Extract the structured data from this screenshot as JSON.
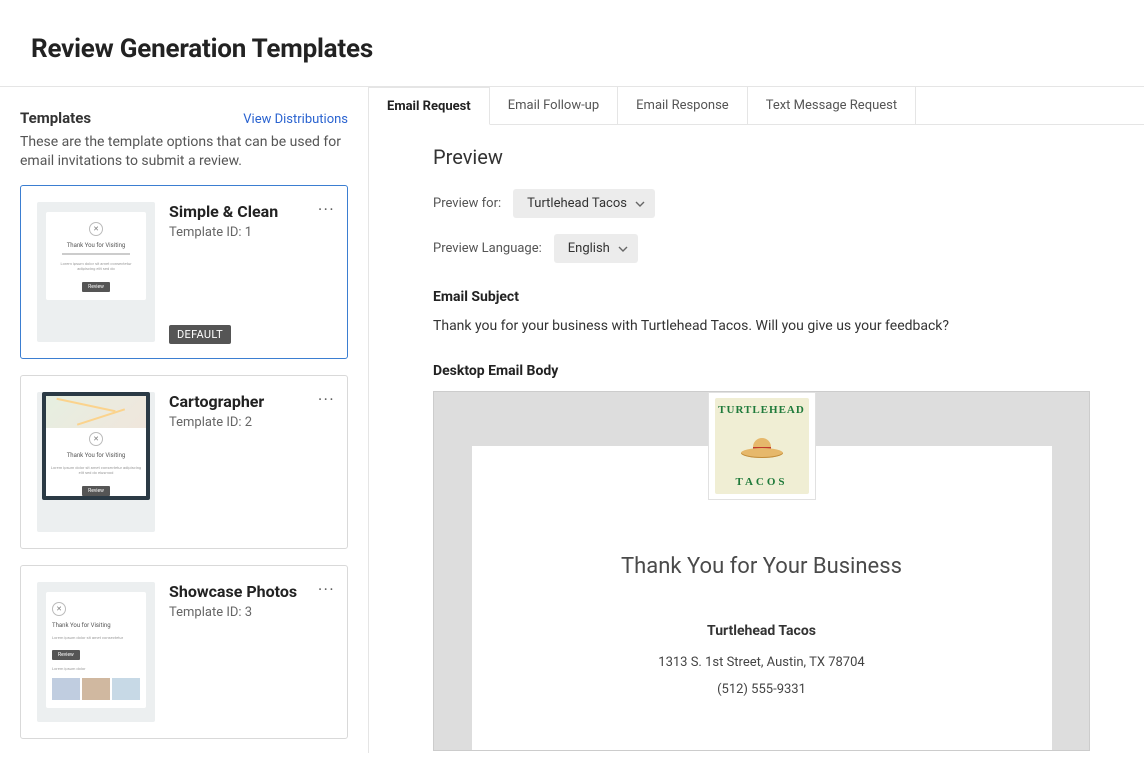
{
  "page": {
    "title": "Review Generation Templates"
  },
  "sidebar": {
    "heading": "Templates",
    "view_link": "View Distributions",
    "description": "These are the template options that can be used for email invitations to submit a review.",
    "default_badge": "DEFAULT",
    "templates": [
      {
        "name": "Simple & Clean",
        "id_label": "Template ID: 1",
        "selected": true,
        "default": true
      },
      {
        "name": "Cartographer",
        "id_label": "Template ID: 2",
        "selected": false,
        "default": false
      },
      {
        "name": "Showcase Photos",
        "id_label": "Template ID: 3",
        "selected": false,
        "default": false
      }
    ]
  },
  "main": {
    "tabs": [
      {
        "label": "Email Request",
        "active": true
      },
      {
        "label": "Email Follow-up",
        "active": false
      },
      {
        "label": "Email Response",
        "active": false
      },
      {
        "label": "Text Message Request",
        "active": false
      }
    ],
    "preview_heading": "Preview",
    "preview_for_label": "Preview for:",
    "preview_for_value": "Turtlehead Tacos",
    "preview_lang_label": "Preview Language:",
    "preview_lang_value": "English",
    "subject_label": "Email Subject",
    "subject_text": "Thank you for your business with Turtlehead Tacos. Will you give us your feedback?",
    "body_label": "Desktop Email Body",
    "email": {
      "logo_brand_top": "TURTLEHEAD",
      "logo_brand_bottom": "TACOS",
      "headline": "Thank You for Your Business",
      "business_name": "Turtlehead Tacos",
      "address": "1313 S. 1st Street, Austin, TX 78704",
      "phone": "(512) 555-9331"
    }
  }
}
